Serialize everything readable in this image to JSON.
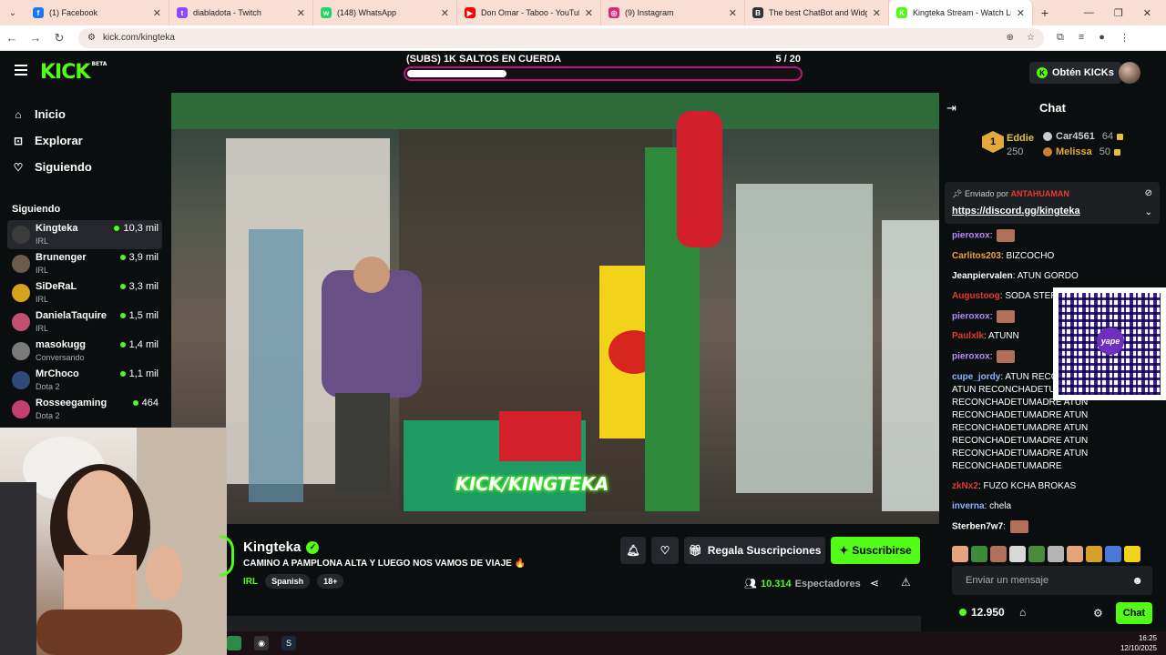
{
  "browser": {
    "tabs": [
      {
        "title": "(1) Facebook",
        "color": "#1877f2",
        "glyph": "f"
      },
      {
        "title": "diabladota - Twitch",
        "color": "#9146ff",
        "glyph": "t"
      },
      {
        "title": "(148) WhatsApp",
        "color": "#25d366",
        "glyph": "w"
      },
      {
        "title": "Don Omar - Taboo - YouTube",
        "color": "#ff0000",
        "glyph": "▶"
      },
      {
        "title": "(9) Instagram",
        "color": "#d62976",
        "glyph": "◎"
      },
      {
        "title": "The best ChatBot and Widgets",
        "color": "#333333",
        "glyph": "B"
      },
      {
        "title": "Kingteka Stream - Watch Li",
        "color": "#53fc18",
        "glyph": "K"
      }
    ],
    "url": "kick.com/kingteka"
  },
  "kick": {
    "logo": "KICK",
    "logo_sup": "BETA",
    "goal_title": "(SUBS) 1K SALTOS EN CUERDA",
    "goal_count": "5  / 20",
    "goal_progress": 0.25,
    "obten_label": "Obtén KICKs"
  },
  "sidebar": {
    "nav": [
      {
        "label": "Inicio",
        "icon": "home-icon",
        "glyph": "⌂"
      },
      {
        "label": "Explorar",
        "icon": "compass-icon",
        "glyph": "⊡"
      },
      {
        "label": "Siguiendo",
        "icon": "heart-icon",
        "glyph": "♡"
      }
    ],
    "following_title": "Siguiendo",
    "following": [
      {
        "name": "Kingteka",
        "category": "IRL",
        "viewers": "10,3 mil",
        "color": "#3b3b3b"
      },
      {
        "name": "Brunenger",
        "category": "IRL",
        "viewers": "3,9 mil",
        "color": "#6a5b4a"
      },
      {
        "name": "SiDeRaL",
        "category": "IRL",
        "viewers": "3,3 mil",
        "color": "#d8a31c"
      },
      {
        "name": "DanielaTaquire",
        "category": "IRL",
        "viewers": "1,5 mil",
        "color": "#c25070"
      },
      {
        "name": "masokugg",
        "category": "Conversando",
        "viewers": "1,4 mil",
        "color": "#7a7a7a"
      },
      {
        "name": "MrChoco",
        "category": "Dota 2",
        "viewers": "1,1 mil",
        "color": "#2f4a7a"
      },
      {
        "name": "Rosseegaming",
        "category": "Dota 2",
        "viewers": "464",
        "color": "#c2406f"
      }
    ]
  },
  "video": {
    "watermark": "KICK/KINGTEKA"
  },
  "stream": {
    "channel": "Kingteka",
    "title": "CAMINO A PAMPLONA ALTA Y LUEGO NOS VAMOS DE VIAJE 🔥",
    "category": "IRL",
    "tags": [
      "Spanish",
      "18+"
    ],
    "gift_label": "Regala Suscripciones",
    "subscribe_label": "Suscribirse",
    "viewers": "10.314",
    "viewers_label": "Espectadores"
  },
  "chat": {
    "title": "Chat",
    "leaderboard": {
      "first_rank": "1",
      "first_name": "Eddie",
      "first_value": "250",
      "second_name": "Car4561",
      "second_value": "64",
      "third_name": "Melissa",
      "third_value": "50"
    },
    "pinned_by_label": "Enviado por",
    "pinned_by_user": "ANTAHUAMAN",
    "pinned_link": "https://discord.gg/kingteka",
    "messages": [
      {
        "user": "pieroxox",
        "color": "#b889ff",
        "text": "",
        "emote": true
      },
      {
        "user": "Carlitos203",
        "color": "#f3a03b",
        "text": "BIZCOCHO",
        "emote": false
      },
      {
        "user": "Jeanpiervalen",
        "color": "#ffffff",
        "text": "ATUN GORDO",
        "emote": false
      },
      {
        "user": "Augustoog",
        "color": "#e53935",
        "text": "SODA STEREO",
        "emote": false
      },
      {
        "user": "pieroxox",
        "color": "#b889ff",
        "text": "",
        "emote": true
      },
      {
        "user": "Paulxlk",
        "color": "#e53935",
        "text": "ATUNN",
        "emote": false
      },
      {
        "user": "pieroxox",
        "color": "#b889ff",
        "text": "",
        "emote": true
      },
      {
        "user": "cupe_jordy",
        "color": "#8ab4ff",
        "text": "ATUN RECONCHADETUMADRE ATUN RECONCHADETUMADRE ATUN RECONCHADETUMADRE ATUN RECONCHADETUMADRE ATUN RECONCHADETUMADRE ATUN RECONCHADETUMADRE ATUN RECONCHADETUMADRE ATUN RECONCHADETUMADRE",
        "emote": false
      },
      {
        "user": "zkNx2",
        "color": "#e53935",
        "text": "FUZO KCHA BROKAS",
        "emote": false
      },
      {
        "user": "inverna",
        "color": "#8ab4ff",
        "text": "chela",
        "emote": false
      },
      {
        "user": "Sterben7w7",
        "color": "#ffffff",
        "text": "",
        "emote": true
      }
    ],
    "qr_label": "yape",
    "input_placeholder": "Enviar un mensaje",
    "points": "12.950",
    "send_label": "Chat"
  },
  "taskbar": {
    "time": "16:25",
    "date": "12/10/2025"
  }
}
